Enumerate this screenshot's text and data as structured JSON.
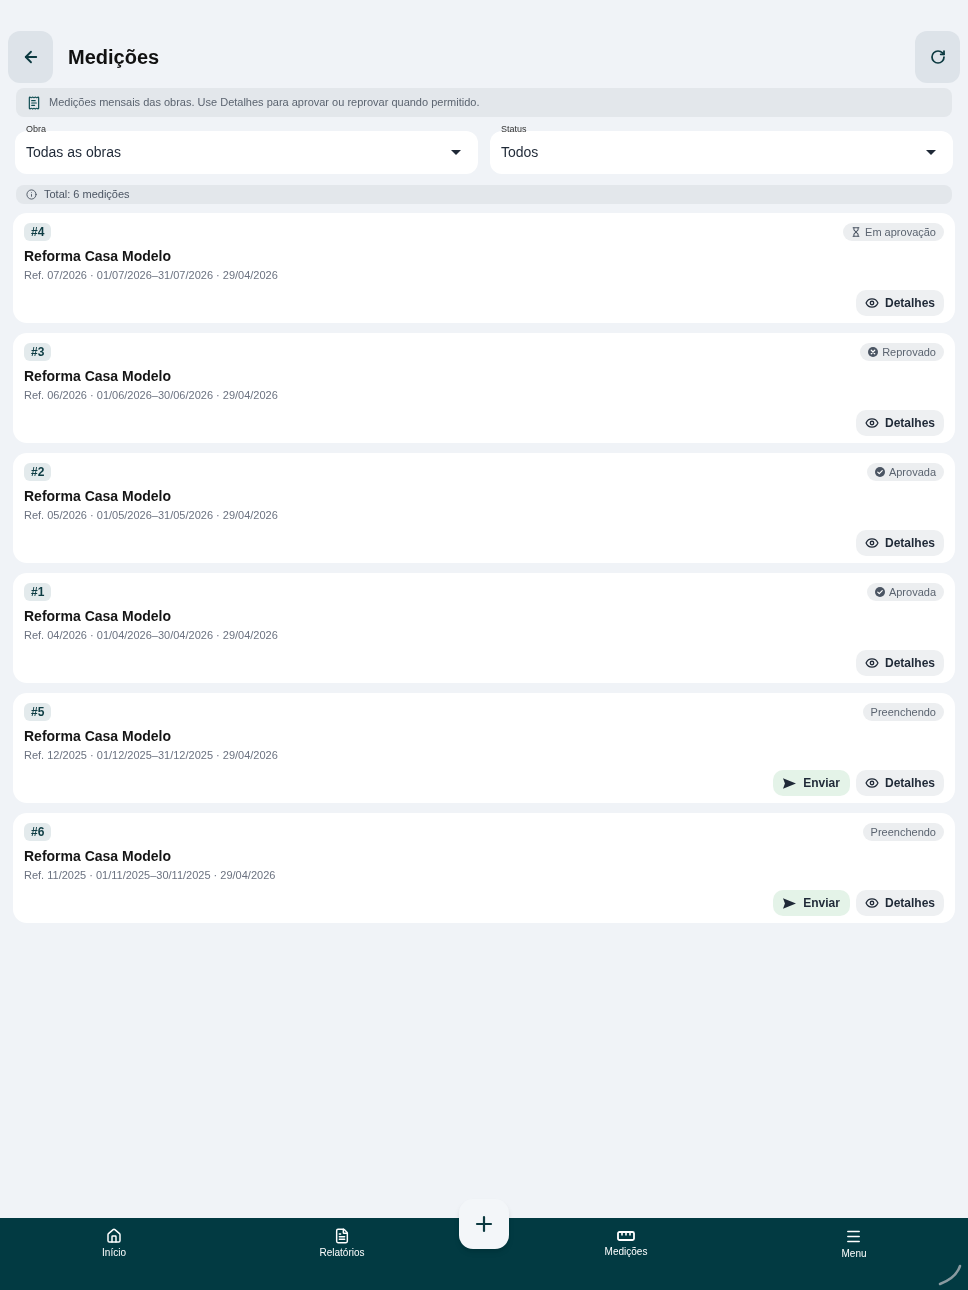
{
  "header": {
    "title": "Medições"
  },
  "info_banner": {
    "text": "Medições mensais das obras. Use Detalhes para aprovar ou reprovar quando permitido."
  },
  "filters": [
    {
      "label": "Obra",
      "value": "Todas as obras"
    },
    {
      "label": "Status",
      "value": "Todos"
    }
  ],
  "total": "Total: 6 medições",
  "measurements": [
    {
      "number": "#4",
      "status": {
        "kind": "pending",
        "label": "Em aprovação"
      },
      "title": "Reforma Casa Modelo",
      "details": "Ref. 07/2026 · 01/07/2026–31/07/2026 · 29/04/2026",
      "actions": [
        {
          "kind": "details",
          "label": "Detalhes"
        }
      ]
    },
    {
      "number": "#3",
      "status": {
        "kind": "rejected",
        "label": "Reprovado"
      },
      "title": "Reforma Casa Modelo",
      "details": "Ref. 06/2026 · 01/06/2026–30/06/2026 · 29/04/2026",
      "actions": [
        {
          "kind": "details",
          "label": "Detalhes"
        }
      ]
    },
    {
      "number": "#2",
      "status": {
        "kind": "approved",
        "label": "Aprovada"
      },
      "title": "Reforma Casa Modelo",
      "details": "Ref. 05/2026 · 01/05/2026–31/05/2026 · 29/04/2026",
      "actions": [
        {
          "kind": "details",
          "label": "Detalhes"
        }
      ]
    },
    {
      "number": "#1",
      "status": {
        "kind": "approved",
        "label": "Aprovada"
      },
      "title": "Reforma Casa Modelo",
      "details": "Ref. 04/2026 · 01/04/2026–30/04/2026 · 29/04/2026",
      "actions": [
        {
          "kind": "details",
          "label": "Detalhes"
        }
      ]
    },
    {
      "number": "#5",
      "status": {
        "kind": "filling",
        "label": "Preenchendo"
      },
      "title": "Reforma Casa Modelo",
      "details": "Ref. 12/2025 · 01/12/2025–31/12/2025 · 29/04/2026",
      "actions": [
        {
          "kind": "send",
          "label": "Enviar"
        },
        {
          "kind": "details",
          "label": "Detalhes"
        }
      ]
    },
    {
      "number": "#6",
      "status": {
        "kind": "filling",
        "label": "Preenchendo"
      },
      "title": "Reforma Casa Modelo",
      "details": "Ref. 11/2025 · 01/11/2025–30/11/2025 · 29/04/2026",
      "actions": [
        {
          "kind": "send",
          "label": "Enviar"
        },
        {
          "kind": "details",
          "label": "Detalhes"
        }
      ]
    }
  ],
  "bottom_nav": {
    "items": [
      {
        "label": "Início"
      },
      {
        "label": "Relatórios"
      },
      {
        "label": "Medições"
      },
      {
        "label": "Menu"
      }
    ]
  }
}
